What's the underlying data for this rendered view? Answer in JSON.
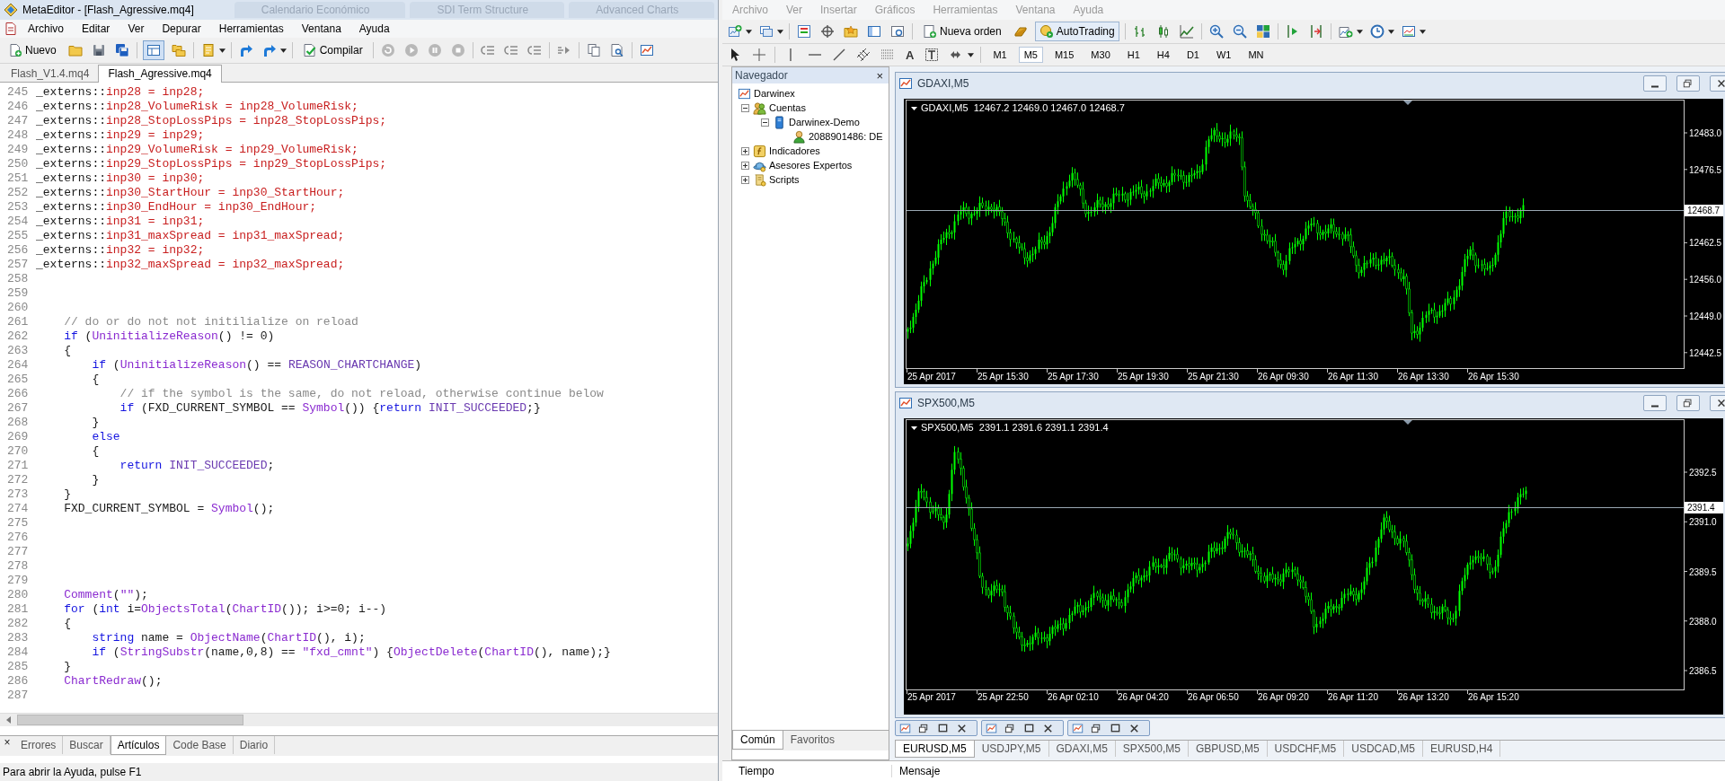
{
  "editor": {
    "title": "MetaEditor - [Flash_Agressive.mq4]",
    "background_tabs": [
      "Calendario Económico",
      "SDI Term Structure",
      "Advanced Charts"
    ],
    "menu": [
      "Archivo",
      "Editar",
      "Ver",
      "Depurar",
      "Herramientas",
      "Ventana",
      "Ayuda"
    ],
    "toolbar": {
      "new": "Nuevo",
      "compile": "Compilar",
      "layout_on": true
    },
    "file_tabs": [
      {
        "label": "Flash_V1.4.mq4",
        "selected": false
      },
      {
        "label": "Flash_Agressive.mq4",
        "selected": true
      }
    ],
    "code": [
      {
        "n": "245",
        "s": [
          {
            "text": "_externs::",
            "kind": "plain"
          },
          {
            "text": "inp28 = inp28;",
            "kind": "extern"
          }
        ]
      },
      {
        "n": "246",
        "s": [
          {
            "text": "_externs::",
            "kind": "plain"
          },
          {
            "text": "inp28_VolumeRisk = inp28_VolumeRisk;",
            "kind": "extern"
          }
        ]
      },
      {
        "n": "247",
        "s": [
          {
            "text": "_externs::",
            "kind": "plain"
          },
          {
            "text": "inp28_StopLossPips = inp28_StopLossPips;",
            "kind": "extern"
          }
        ]
      },
      {
        "n": "248",
        "s": [
          {
            "text": "_externs::",
            "kind": "plain"
          },
          {
            "text": "inp29 = inp29;",
            "kind": "extern"
          }
        ]
      },
      {
        "n": "249",
        "s": [
          {
            "text": "_externs::",
            "kind": "plain"
          },
          {
            "text": "inp29_VolumeRisk = inp29_VolumeRisk;",
            "kind": "extern"
          }
        ]
      },
      {
        "n": "250",
        "s": [
          {
            "text": "_externs::",
            "kind": "plain"
          },
          {
            "text": "inp29_StopLossPips = inp29_StopLossPips;",
            "kind": "extern"
          }
        ]
      },
      {
        "n": "251",
        "s": [
          {
            "text": "_externs::",
            "kind": "plain"
          },
          {
            "text": "inp30 = inp30;",
            "kind": "extern"
          }
        ]
      },
      {
        "n": "252",
        "s": [
          {
            "text": "_externs::",
            "kind": "plain"
          },
          {
            "text": "inp30_StartHour = inp30_StartHour;",
            "kind": "extern"
          }
        ]
      },
      {
        "n": "253",
        "s": [
          {
            "text": "_externs::",
            "kind": "plain"
          },
          {
            "text": "inp30_EndHour = inp30_EndHour;",
            "kind": "extern"
          }
        ]
      },
      {
        "n": "254",
        "s": [
          {
            "text": "_externs::",
            "kind": "plain"
          },
          {
            "text": "inp31 = inp31;",
            "kind": "extern"
          }
        ]
      },
      {
        "n": "255",
        "s": [
          {
            "text": "_externs::",
            "kind": "plain"
          },
          {
            "text": "inp31_maxSpread = inp31_maxSpread;",
            "kind": "extern"
          }
        ]
      },
      {
        "n": "256",
        "s": [
          {
            "text": "_externs::",
            "kind": "plain"
          },
          {
            "text": "inp32 = inp32;",
            "kind": "extern"
          }
        ]
      },
      {
        "n": "257",
        "s": [
          {
            "text": "_externs::",
            "kind": "plain"
          },
          {
            "text": "inp32_maxSpread = inp32_maxSpread;",
            "kind": "extern"
          }
        ]
      },
      {
        "n": "258"
      },
      {
        "n": "259"
      },
      {
        "n": "260"
      },
      {
        "n": "261",
        "s": [
          {
            "text": "    // do or do not not initilialize on reload",
            "kind": "comment"
          }
        ]
      },
      {
        "n": "262",
        "s": [
          {
            "text": "    if",
            "kind": "keyword"
          },
          {
            "text": " (",
            "kind": "plain"
          },
          {
            "text": "UninitializeReason",
            "kind": "function"
          },
          {
            "text": "() != 0)",
            "kind": "plain"
          }
        ]
      },
      {
        "n": "263",
        "s": [
          {
            "text": "    {",
            "kind": "plain"
          }
        ]
      },
      {
        "n": "264",
        "s": [
          {
            "text": "        if",
            "kind": "keyword"
          },
          {
            "text": " (",
            "kind": "plain"
          },
          {
            "text": "UninitializeReason",
            "kind": "function"
          },
          {
            "text": "() == ",
            "kind": "plain"
          },
          {
            "text": "REASON_CHARTCHANGE",
            "kind": "constant"
          },
          {
            "text": ")",
            "kind": "plain"
          }
        ]
      },
      {
        "n": "265",
        "s": [
          {
            "text": "        {",
            "kind": "plain"
          }
        ]
      },
      {
        "n": "266",
        "s": [
          {
            "text": "            // if the symbol is the same, do not reload, otherwise continue below",
            "kind": "comment"
          }
        ]
      },
      {
        "n": "267",
        "s": [
          {
            "text": "            if",
            "kind": "keyword"
          },
          {
            "text": " (FXD_CURRENT_SYMBOL == ",
            "kind": "plain"
          },
          {
            "text": "Symbol",
            "kind": "function"
          },
          {
            "text": "()) {",
            "kind": "plain"
          },
          {
            "text": "return ",
            "kind": "keyword"
          },
          {
            "text": "INIT_SUCCEEDED",
            "kind": "constant"
          },
          {
            "text": ";}",
            "kind": "plain"
          }
        ]
      },
      {
        "n": "268",
        "s": [
          {
            "text": "        }",
            "kind": "plain"
          }
        ]
      },
      {
        "n": "269",
        "s": [
          {
            "text": "        else",
            "kind": "keyword"
          }
        ]
      },
      {
        "n": "270",
        "s": [
          {
            "text": "        {",
            "kind": "plain"
          }
        ]
      },
      {
        "n": "271",
        "s": [
          {
            "text": "            return ",
            "kind": "keyword"
          },
          {
            "text": "INIT_SUCCEEDED",
            "kind": "constant"
          },
          {
            "text": ";",
            "kind": "plain"
          }
        ]
      },
      {
        "n": "272",
        "s": [
          {
            "text": "        }",
            "kind": "plain"
          }
        ]
      },
      {
        "n": "273",
        "s": [
          {
            "text": "    }",
            "kind": "plain"
          }
        ]
      },
      {
        "n": "274",
        "s": [
          {
            "text": "    FXD_CURRENT_SYMBOL = ",
            "kind": "plain"
          },
          {
            "text": "Symbol",
            "kind": "function"
          },
          {
            "text": "();",
            "kind": "plain"
          }
        ]
      },
      {
        "n": "275"
      },
      {
        "n": "276"
      },
      {
        "n": "277"
      },
      {
        "n": "278"
      },
      {
        "n": "279"
      },
      {
        "n": "280",
        "s": [
          {
            "text": "    Comment",
            "kind": "function"
          },
          {
            "text": "(",
            "kind": "plain"
          },
          {
            "text": "\"\"",
            "kind": "string"
          },
          {
            "text": ");",
            "kind": "plain"
          }
        ]
      },
      {
        "n": "281",
        "s": [
          {
            "text": "    for",
            "kind": "keyword"
          },
          {
            "text": " (",
            "kind": "plain"
          },
          {
            "text": "int",
            "kind": "keyword"
          },
          {
            "text": " i=",
            "kind": "plain"
          },
          {
            "text": "ObjectsTotal",
            "kind": "function"
          },
          {
            "text": "(",
            "kind": "plain"
          },
          {
            "text": "ChartID",
            "kind": "function"
          },
          {
            "text": "()); i>=0; i--)",
            "kind": "plain"
          }
        ]
      },
      {
        "n": "282",
        "s": [
          {
            "text": "    {",
            "kind": "plain"
          }
        ]
      },
      {
        "n": "283",
        "s": [
          {
            "text": "        string",
            "kind": "keyword"
          },
          {
            "text": " name = ",
            "kind": "plain"
          },
          {
            "text": "ObjectName",
            "kind": "function"
          },
          {
            "text": "(",
            "kind": "plain"
          },
          {
            "text": "ChartID",
            "kind": "function"
          },
          {
            "text": "(), i);",
            "kind": "plain"
          }
        ]
      },
      {
        "n": "284",
        "s": [
          {
            "text": "        if",
            "kind": "keyword"
          },
          {
            "text": " (",
            "kind": "plain"
          },
          {
            "text": "StringSubstr",
            "kind": "function"
          },
          {
            "text": "(name,0,8) == ",
            "kind": "plain"
          },
          {
            "text": "\"fxd_cmnt\"",
            "kind": "string"
          },
          {
            "text": ") {",
            "kind": "plain"
          },
          {
            "text": "ObjectDelete",
            "kind": "function"
          },
          {
            "text": "(",
            "kind": "plain"
          },
          {
            "text": "ChartID",
            "kind": "function"
          },
          {
            "text": "(), name);}",
            "kind": "plain"
          }
        ]
      },
      {
        "n": "285",
        "s": [
          {
            "text": "    }",
            "kind": "plain"
          }
        ]
      },
      {
        "n": "286",
        "s": [
          {
            "text": "    ChartRedraw",
            "kind": "function"
          },
          {
            "text": "();",
            "kind": "plain"
          }
        ]
      },
      {
        "n": "287"
      }
    ],
    "toolbox_close": "×",
    "bottom_tabs": [
      {
        "label": "Errores",
        "selected": false
      },
      {
        "label": "Buscar",
        "selected": false
      },
      {
        "label": "Artículos",
        "selected": true
      },
      {
        "label": "Code Base",
        "selected": false
      },
      {
        "label": "Diario",
        "selected": false
      }
    ],
    "status": "Para abrir la Ayuda, pulse F1"
  },
  "terminal": {
    "active": false,
    "menu": [
      "Archivo",
      "Ver",
      "Insertar",
      "Gráficos",
      "Herramientas",
      "Ventana",
      "Ayuda"
    ],
    "toolbar": {
      "new_order": "Nueva orden",
      "autotrading": {
        "label": "AutoTrading",
        "on": true
      }
    },
    "text_tool": "A",
    "timeframes": [
      {
        "label": "M1",
        "selected": false
      },
      {
        "label": "M5",
        "selected": true
      },
      {
        "label": "M15",
        "selected": false
      },
      {
        "label": "M30",
        "selected": false
      },
      {
        "label": "H1",
        "selected": false
      },
      {
        "label": "H4",
        "selected": false
      },
      {
        "label": "D1",
        "selected": false
      },
      {
        "label": "W1",
        "selected": false
      },
      {
        "label": "MN",
        "selected": false
      }
    ],
    "navigator": {
      "title": "Navegador",
      "close": "×",
      "tree": [
        {
          "label": "Darwinex",
          "kind": "broker",
          "children": [
            {
              "label": "Cuentas",
              "kind": "accounts",
              "expanded": true,
              "children": [
                {
                  "label": "Darwinex-Demo",
                  "kind": "server",
                  "expanded": true,
                  "children": [
                    {
                      "label": "2088901486: DE",
                      "kind": "account"
                    }
                  ]
                }
              ]
            },
            {
              "label": "Indicadores",
              "kind": "indicators",
              "expanded": false
            },
            {
              "label": "Asesores Expertos",
              "kind": "experts",
              "expanded": false
            },
            {
              "label": "Scripts",
              "kind": "scripts",
              "expanded": false
            }
          ]
        }
      ],
      "tabs": [
        {
          "label": "Común",
          "selected": true
        },
        {
          "label": "Favoritos",
          "selected": false
        }
      ]
    },
    "charts": [
      {
        "title": "GDAXI,M5",
        "header": "GDAXI,M5  12467.2 12469.0 12467.0 12468.7",
        "prices": [
          "12483.0",
          "12476.5",
          "12462.5",
          "12456.0",
          "12449.0",
          "12442.5"
        ],
        "current": "12468.7",
        "times": [
          "25 Apr 2017",
          "25 Apr 15:30",
          "25 Apr 17:30",
          "25 Apr 19:30",
          "25 Apr 21:30",
          "26 Apr 09:30",
          "26 Apr 11:30",
          "26 Apr 13:30",
          "26 Apr 15:30"
        ]
      },
      {
        "title": "SPX500,M5",
        "header": "SPX500,M5  2391.1 2391.6 2391.1 2391.4",
        "prices": [
          "2392.5",
          "2391.0",
          "2389.5",
          "2388.0",
          "2386.5"
        ],
        "current": "2391.4",
        "times": [
          "25 Apr 2017",
          "25 Apr 22:50",
          "26 Apr 02:10",
          "26 Apr 04:20",
          "26 Apr 06:50",
          "26 Apr 09:20",
          "26 Apr 11:20",
          "26 Apr 13:20",
          "26 Apr 15:20"
        ]
      }
    ],
    "symbol_tabs": [
      {
        "label": "EURUSD,M5",
        "selected": true
      },
      {
        "label": "USDJPY,M5",
        "selected": false
      },
      {
        "label": "GDAXI,M5",
        "selected": false
      },
      {
        "label": "SPX500,M5",
        "selected": false
      },
      {
        "label": "GBPUSD,M5",
        "selected": false
      },
      {
        "label": "USDCHF,M5",
        "selected": false
      },
      {
        "label": "USDCAD,M5",
        "selected": false
      },
      {
        "label": "EURUSD,H4",
        "selected": false
      }
    ],
    "journal_columns": [
      "Tiempo",
      "Mensaje"
    ]
  }
}
